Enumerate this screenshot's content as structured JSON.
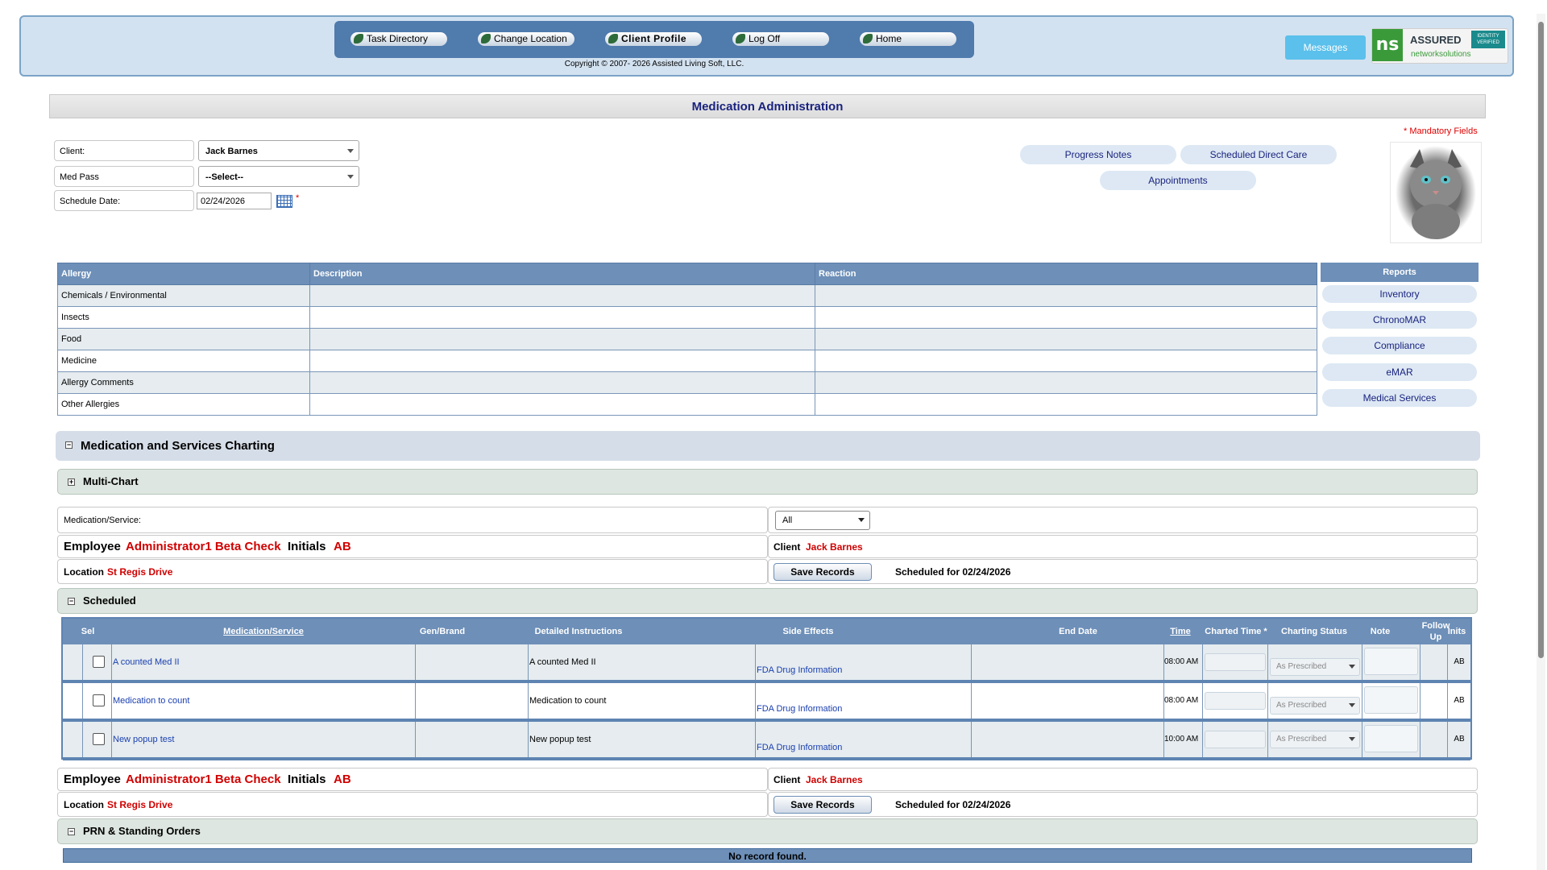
{
  "nav": {
    "items": [
      "Task Directory",
      "Change Location",
      "Client Profile",
      "Log Off",
      "Home"
    ],
    "copyright": "Copyright © 2007- 2026 Assisted Living Soft, LLC.",
    "messages": "Messages",
    "badge": {
      "logo": "ns",
      "assured": "ASSURED",
      "verified": "IDENTITY VERIFIED",
      "name": "networksolutions"
    }
  },
  "page_title": "Medication Administration",
  "mandatory": "* Mandatory Fields",
  "form": {
    "client_label": "Client:",
    "client_value": "Jack Barnes",
    "medpass_label": "Med Pass",
    "medpass_value": "--Select--",
    "date_label": "Schedule Date:",
    "date_value": "02/24/2026"
  },
  "quick_links": {
    "progress": "Progress Notes",
    "direct_care": "Scheduled Direct Care",
    "appointments": "Appointments"
  },
  "allergy": {
    "headers": [
      "Allergy",
      "Description",
      "Reaction"
    ],
    "rows": [
      "Chemicals / Environmental",
      "Insects",
      "Food",
      "Medicine",
      "Allergy Comments",
      "Other Allergies"
    ]
  },
  "reports": {
    "header": "Reports",
    "items": [
      "Inventory",
      "ChronoMAR",
      "Compliance",
      "eMAR",
      "Medical Services"
    ]
  },
  "sections": {
    "charting": "Medication and Services Charting",
    "multi_chart": "Multi-Chart",
    "scheduled": "Scheduled",
    "prn": "PRN & Standing Orders"
  },
  "filter": {
    "label": "Medication/Service:",
    "value": "All"
  },
  "employee": {
    "label": "Employee",
    "name": "Administrator1 Beta Check",
    "initials_label": "Initials",
    "initials": "AB"
  },
  "client": {
    "label": "Client",
    "name": "Jack Barnes"
  },
  "location": {
    "label": "Location",
    "name": "St Regis Drive"
  },
  "save_label": "Save Records",
  "scheduled_for": "Scheduled for 02/24/2026",
  "sched_headers": {
    "sel": "Sel",
    "med": "Medication/Service",
    "gen": "Gen/Brand",
    "instr": "Detailed Instructions",
    "side": "Side Effects",
    "end": "End Date",
    "time": "Time",
    "charted": "Charted Time *",
    "status": "Charting Status",
    "note": "Note",
    "follow": "Follow Up",
    "inits": "Inits"
  },
  "sched_rows": [
    {
      "med": "A counted Med II",
      "instr": "A counted Med II",
      "side": "FDA Drug Information",
      "time": "08:00 AM",
      "status": "As Prescribed",
      "inits": "AB"
    },
    {
      "med": "Medication to count",
      "instr": "Medication to count",
      "side": "FDA Drug Information",
      "time": "08:00 AM",
      "status": "As Prescribed",
      "inits": "AB"
    },
    {
      "med": "New popup test",
      "instr": "New popup test",
      "side": "FDA Drug Information",
      "time": "10:00 AM",
      "status": "As Prescribed",
      "inits": "AB"
    }
  ],
  "no_record": "No record found."
}
